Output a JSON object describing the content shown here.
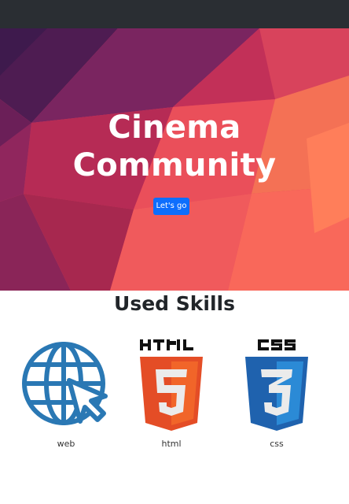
{
  "hero": {
    "title_line1": "Cinema",
    "title_line2": "Community",
    "cta_label": "Let's go"
  },
  "skills": {
    "title": "Used Skills",
    "items": [
      {
        "label": "web",
        "icon": "globe-cursor-icon",
        "color": "#2a78b4"
      },
      {
        "label": "html",
        "icon": "html5-icon",
        "color": "#e44d26"
      },
      {
        "label": "css",
        "icon": "css3-icon",
        "color": "#1f62ae"
      }
    ]
  },
  "colors": {
    "navbar": "#2a2e33",
    "cta": "#0d6efd",
    "hero_pink": "#f25a5f",
    "hero_purple": "#5e1d57"
  }
}
